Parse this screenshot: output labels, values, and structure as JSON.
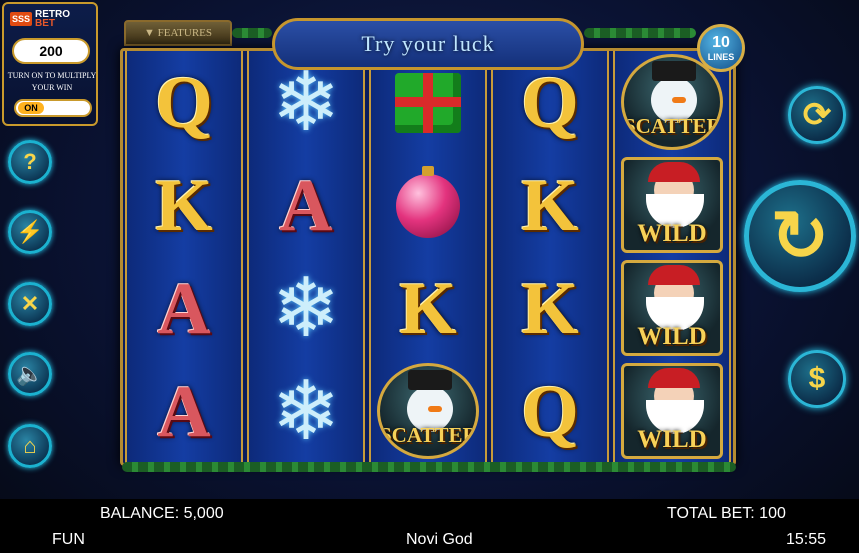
{
  "promo": {
    "logo_box": "SSS",
    "logo_line1": "RETRO",
    "logo_line2": "BET",
    "multiplier_value": "200",
    "multiply_label": "TURN ON TO MULTIPLY YOUR WIN",
    "toggle_label": "ON"
  },
  "header": {
    "title": "Try your luck",
    "features_label": "FEATURES",
    "lines_count": "10",
    "lines_label": "LINES"
  },
  "reels": [
    [
      {
        "sym": "Q",
        "style": "gold"
      },
      {
        "sym": "K",
        "style": "gold"
      },
      {
        "sym": "A",
        "style": "red"
      },
      {
        "sym": "A",
        "style": "red"
      }
    ],
    [
      {
        "sym": "snowflake"
      },
      {
        "sym": "A",
        "style": "red"
      },
      {
        "sym": "snowflake"
      },
      {
        "sym": "snowflake"
      }
    ],
    [
      {
        "sym": "gift"
      },
      {
        "sym": "ornament"
      },
      {
        "sym": "K",
        "style": "gold"
      },
      {
        "sym": "scatter"
      }
    ],
    [
      {
        "sym": "Q",
        "style": "gold"
      },
      {
        "sym": "K",
        "style": "gold"
      },
      {
        "sym": "K",
        "style": "gold"
      },
      {
        "sym": "Q",
        "style": "gold"
      }
    ],
    [
      {
        "sym": "scatter"
      },
      {
        "sym": "wild"
      },
      {
        "sym": "wild"
      },
      {
        "sym": "wild"
      }
    ]
  ],
  "symbols": {
    "wild_label": "WILD",
    "scatter_label": "SCATTER",
    "snowflake_glyph": "❄"
  },
  "side_buttons": [
    {
      "name": "help-button",
      "icon": "help-icon",
      "glyph": "?"
    },
    {
      "name": "turbo-button",
      "icon": "lightning-icon",
      "glyph": "⚡"
    },
    {
      "name": "settings-button",
      "icon": "tools-icon",
      "glyph": "✕"
    },
    {
      "name": "sound-button",
      "icon": "speaker-icon",
      "glyph": "🔈"
    },
    {
      "name": "home-button",
      "icon": "home-icon",
      "glyph": "⌂"
    }
  ],
  "right_buttons": {
    "autoplay_glyph": "⟳",
    "spin_glyph": "↻",
    "bet_glyph": "$"
  },
  "footer": {
    "balance": "BALANCE: 5,000",
    "total_bet": "TOTAL BET: 100",
    "mode": "FUN",
    "game_name": "Novi God",
    "clock": "15:55"
  },
  "colors": {
    "gold": "#f3c33b",
    "accent_cyan": "#29c9ee",
    "frame_gold": "#c99a2c"
  }
}
